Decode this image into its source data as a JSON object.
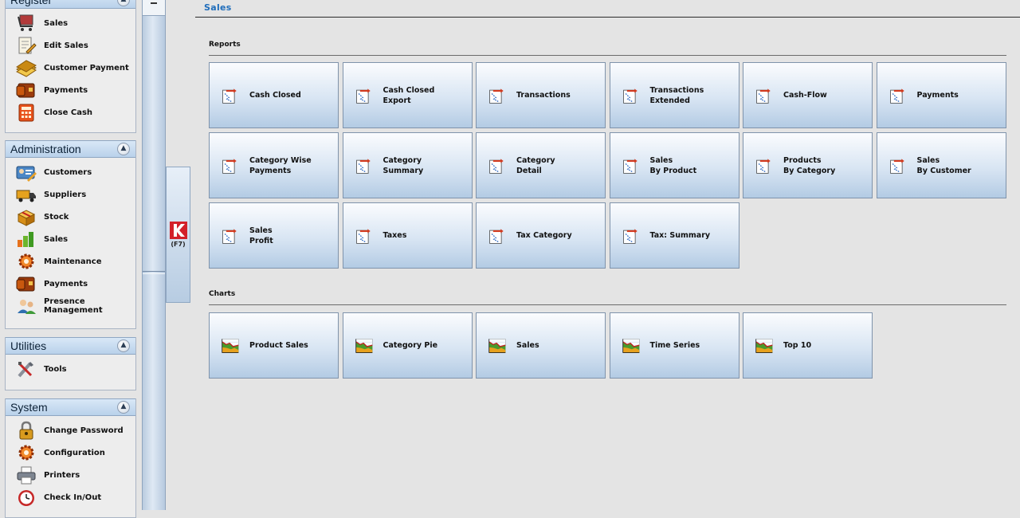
{
  "sidebar": {
    "register": {
      "title": "Register",
      "items": [
        "Sales",
        "Edit Sales",
        "Customer Payment",
        "Payments",
        "Close Cash"
      ]
    },
    "administration": {
      "title": "Administration",
      "items": [
        "Customers",
        "Suppliers",
        "Stock",
        "Sales",
        "Maintenance",
        "Payments",
        "Presence Management"
      ]
    },
    "utilities": {
      "title": "Utilities",
      "items": [
        "Tools"
      ]
    },
    "system": {
      "title": "System",
      "items": [
        "Change Password",
        "Configuration",
        "Printers",
        "Check In/Out"
      ]
    }
  },
  "quick_launch": {
    "key": "(F7)"
  },
  "page": {
    "title": "Sales"
  },
  "reports": {
    "title": "Reports",
    "tiles": [
      "Cash Closed",
      "Cash Closed\nExport",
      "Transactions",
      "Transactions\nExtended",
      "Cash-Flow",
      "Payments",
      "Category Wise\nPayments",
      "Category\nSummary",
      "Category\nDetail",
      "Sales\nBy Product",
      "Products\nBy Category",
      "Sales\nBy Customer",
      "Sales\nProfit",
      "Taxes",
      "Tax Category",
      "Tax: Summary"
    ]
  },
  "charts": {
    "title": "Charts",
    "tiles": [
      "Product Sales",
      "Category Pie",
      "Sales",
      "Time Series",
      "Top 10"
    ]
  },
  "icons": {
    "sidebar": {
      "register": [
        "shopping-cart-icon",
        "edit-document-icon",
        "money-stack-icon",
        "wallet-icon",
        "calculator-icon"
      ],
      "administration": [
        "customer-card-icon",
        "truck-icon",
        "box-icon",
        "bar-chart-icon",
        "gear-icon",
        "wallet-icon",
        "users-icon"
      ],
      "utilities": [
        "tools-icon"
      ],
      "system": [
        "padlock-icon",
        "gear-icon",
        "printer-icon",
        "clock-icon"
      ]
    },
    "report_tile": "report-document-icon",
    "chart_tile": "chart-graph-icon"
  },
  "colors": {
    "accent": "#1f6dbb",
    "tile_top": "#fbfcfe",
    "tile_bottom": "#b3cbe4",
    "panel_header": "#b9d1ea",
    "brand_logo": "#d3202a"
  }
}
